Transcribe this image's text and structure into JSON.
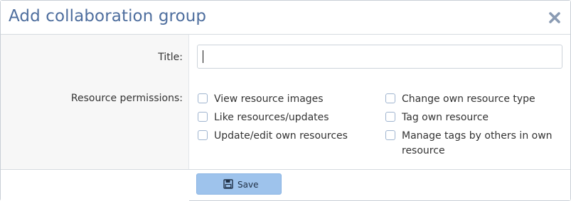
{
  "dialog": {
    "title": "Add collaboration group",
    "close_icon": "close-icon"
  },
  "form": {
    "title_label": "Title:",
    "title_value": "",
    "permissions_label": "Resource permissions:",
    "permissions": [
      {
        "label": "View resource images",
        "checked": false
      },
      {
        "label": "Like resources/updates",
        "checked": false
      },
      {
        "label": "Update/edit own resources",
        "checked": false
      },
      {
        "label": "Change own resource type",
        "checked": false
      },
      {
        "label": "Tag own resource",
        "checked": false
      },
      {
        "label": "Manage tags by others in own resource",
        "checked": false
      }
    ]
  },
  "footer": {
    "save_label": "Save",
    "save_icon": "floppy-disk-icon"
  },
  "colors": {
    "title": "#4e6e9e",
    "save_button": "#9ec3ec",
    "checkbox_border": "#9fb4cf"
  }
}
